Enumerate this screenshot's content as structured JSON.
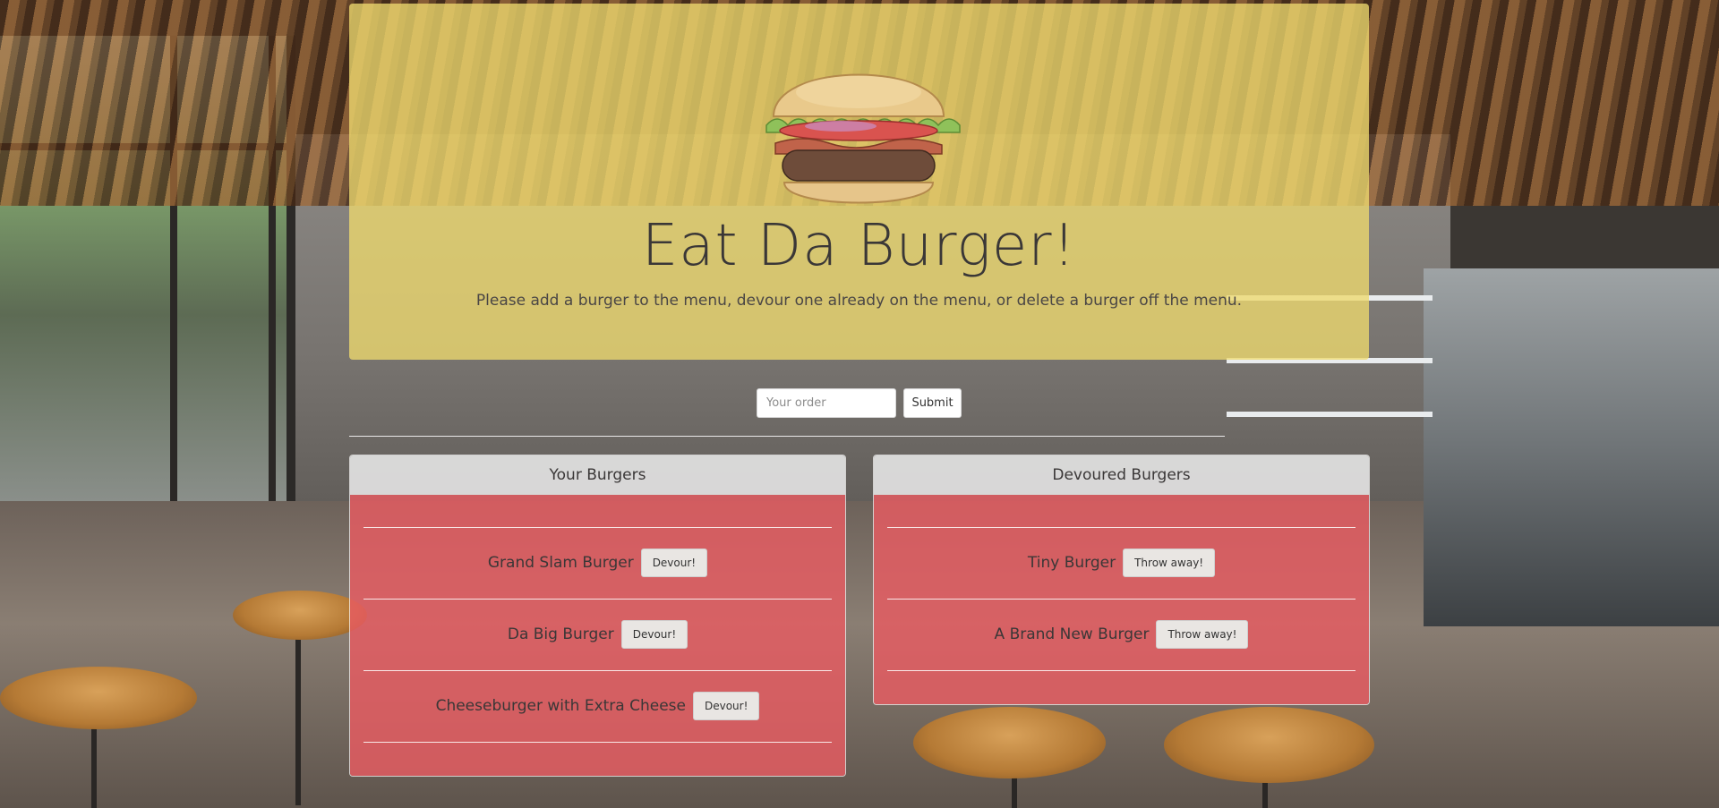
{
  "header": {
    "title": "Eat Da Burger!",
    "subtitle": "Please add a burger to the menu, devour one already on the menu, or delete a burger off the menu."
  },
  "order_form": {
    "placeholder": "Your order",
    "value": "",
    "submit_label": "Submit"
  },
  "your_burgers": {
    "heading": "Your Burgers",
    "action_label": "Devour!",
    "items": [
      "Grand Slam Burger",
      "Da Big Burger",
      "Cheeseburger with Extra Cheese"
    ]
  },
  "devoured_burgers": {
    "heading": "Devoured Burgers",
    "action_label": "Throw away!",
    "items": [
      "Tiny Burger",
      "A Brand New Burger"
    ]
  },
  "colors": {
    "jumbotron": "#eeda6e",
    "panel_body": "#e85c62",
    "panel_heading": "#ececec",
    "text": "#3a3737"
  },
  "icons": {
    "logo": "burger-icon"
  }
}
